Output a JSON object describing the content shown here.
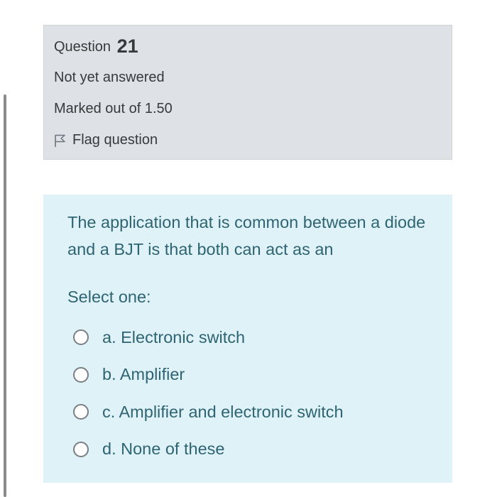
{
  "question_info": {
    "label": "Question",
    "number": "21",
    "state": "Not yet answered",
    "grade": "Marked out of 1.50",
    "flag_label": "Flag question"
  },
  "question": {
    "text": "The application that is common between a diode and a BJT is that both can act as an",
    "prompt": "Select one:",
    "answers": [
      {
        "label": "a. Electronic switch",
        "selected": false
      },
      {
        "label": "b. Amplifier",
        "selected": false
      },
      {
        "label": "c. Amplifier and electronic switch",
        "selected": false
      },
      {
        "label": "d. None of these",
        "selected": false
      }
    ]
  },
  "icons": {
    "flag": "flag-outline-icon"
  },
  "colors": {
    "info_background": "#dee2e6",
    "content_background": "#def2f8",
    "content_text": "#2f6473",
    "info_text": "#373a3c"
  }
}
